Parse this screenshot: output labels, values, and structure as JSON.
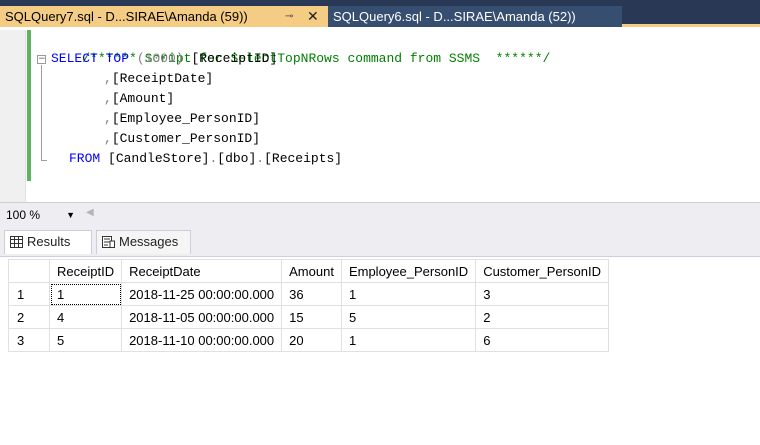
{
  "tabs": [
    {
      "title": "SQLQuery7.sql - D...SIRAE\\Amanda (59))",
      "pin_glyph": "⊸",
      "close_glyph": "✕"
    },
    {
      "title": "SQLQuery6.sql - D...SIRAE\\Amanda (52))"
    }
  ],
  "editor": {
    "comment": "/****** Script for SelectTopNRows command from SSMS  ******/",
    "fold_glyph": "−",
    "select_kw": "SELECT",
    "top_kw": "TOP",
    "top_value": "(1000)",
    "col1": "[ReceiptID]",
    "comma": ",",
    "col2": "[ReceiptDate]",
    "col3": "[Amount]",
    "col4": "[Employee_PersonID]",
    "col5": "[Customer_PersonID]",
    "from_kw": "FROM",
    "db": "[CandleStore]",
    "dot": ".",
    "schema": "[dbo]",
    "table": "[Receipts]"
  },
  "zoom": {
    "value": "100 %",
    "arrow": "▼",
    "scroll_arrow": "◀"
  },
  "results_tabs": {
    "results": "Results",
    "messages": "Messages"
  },
  "grid": {
    "columns": [
      "ReceiptID",
      "ReceiptDate",
      "Amount",
      "Employee_PersonID",
      "Customer_PersonID"
    ],
    "rows": [
      {
        "num": "1",
        "cells": [
          "1",
          "2018-11-25 00:00:00.000",
          "36",
          "1",
          "3"
        ]
      },
      {
        "num": "2",
        "cells": [
          "4",
          "2018-11-05 00:00:00.000",
          "15",
          "5",
          "2"
        ]
      },
      {
        "num": "3",
        "cells": [
          "5",
          "2018-11-10 00:00:00.000",
          "20",
          "1",
          "6"
        ]
      }
    ]
  },
  "colors": {
    "tab_active": "#f5cc84",
    "tab_strip": "#293955",
    "keyword": "#0000ff",
    "comment": "#008000"
  }
}
